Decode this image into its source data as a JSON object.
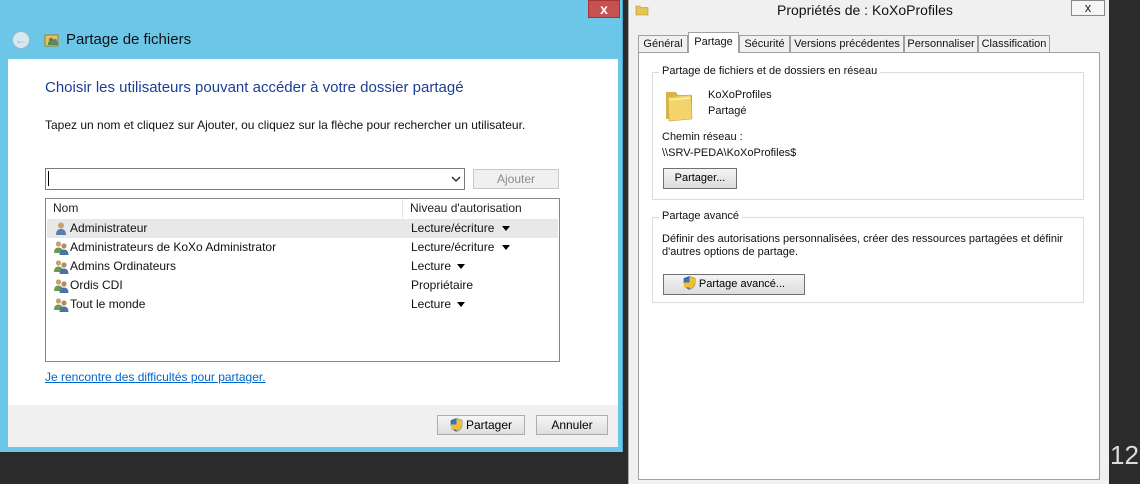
{
  "wizard": {
    "title": "Partage de fichiers",
    "close_glyph": "x",
    "back_glyph": "←",
    "heading": "Choisir les utilisateurs pouvant accéder à votre dossier partagé",
    "instruction": "Tapez un nom et cliquez sur Ajouter, ou cliquez sur la flèche pour rechercher un utilisateur.",
    "input_value": "",
    "add_label": "Ajouter",
    "columns": {
      "name": "Nom",
      "level": "Niveau d'autorisation"
    },
    "rows": [
      {
        "name": "Administrateur",
        "level": "Lecture/écriture",
        "has_dropdown": true,
        "selected": true,
        "icon": "user-icon"
      },
      {
        "name": "Administrateurs de KoXo Administrator",
        "level": "Lecture/écriture",
        "has_dropdown": true,
        "selected": false,
        "icon": "group-icon"
      },
      {
        "name": "Admins Ordinateurs",
        "level": "Lecture",
        "has_dropdown": true,
        "selected": false,
        "icon": "group-icon"
      },
      {
        "name": "Ordis CDI",
        "level": "Propriétaire",
        "has_dropdown": false,
        "selected": false,
        "icon": "group-icon"
      },
      {
        "name": "Tout le monde",
        "level": "Lecture",
        "has_dropdown": true,
        "selected": false,
        "icon": "group-icon"
      }
    ],
    "help_link": "Je rencontre des difficultés pour partager.",
    "share_label": "Partager",
    "cancel_label": "Annuler"
  },
  "properties": {
    "title": "Propriétés de : KoXoProfiles",
    "close_glyph": "x",
    "tabs": [
      "Général",
      "Partage",
      "Sécurité",
      "Versions précédentes",
      "Personnaliser",
      "Classification"
    ],
    "active_tab": "Partage",
    "network_group": {
      "label": "Partage de fichiers et de dossiers en réseau",
      "folder_name": "KoXoProfiles",
      "folder_status": "Partagé",
      "path_label": "Chemin réseau :",
      "path_value": "\\\\SRV-PEDA\\KoXoProfiles$",
      "share_button": "Partager..."
    },
    "advanced_group": {
      "label": "Partage avancé",
      "description_line1": "Définir des autorisations personnalisées, créer des ressources partagées et définir",
      "description_line2": "d'autres options de partage.",
      "button": "Partage avancé..."
    }
  },
  "corner_text": "12",
  "colors": {
    "wizard_frame": "#6bc6e8",
    "heading": "#1c3f94",
    "link": "#0066cc",
    "folder": "#f2d46a"
  }
}
